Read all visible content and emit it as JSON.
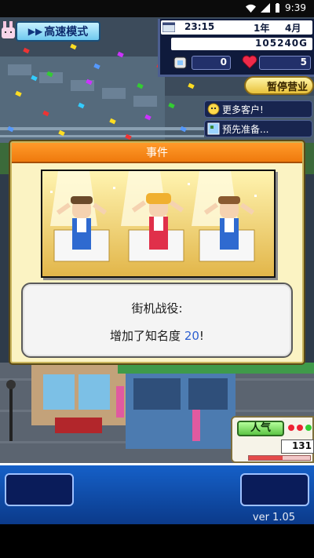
{
  "status_bar": {
    "time": "9:39"
  },
  "hud": {
    "speed_mode_label": "高速模式",
    "date_time": "23:15",
    "year_label": "1年",
    "month_label": "4月",
    "money": "105240G",
    "research_points": "0",
    "hearts": "5",
    "closed_label": "暂停营业",
    "more_customers_label": "更多客户!",
    "prepare_label": "预先准备..."
  },
  "event": {
    "title": "事件",
    "line1": "街机战役:",
    "line2_prefix": "增加了知名度 ",
    "line2_value": "20",
    "line2_suffix": "!"
  },
  "popularity": {
    "label": "人气",
    "value": "131",
    "level": 0.55
  },
  "footer": {
    "version": "ver 1.05"
  },
  "colors": {
    "header_orange": "#ef7a0d",
    "dialog_bg": "#fbf3c3",
    "bottom_blue": "#1560c8",
    "highlight_blue": "#2d5fd0"
  }
}
